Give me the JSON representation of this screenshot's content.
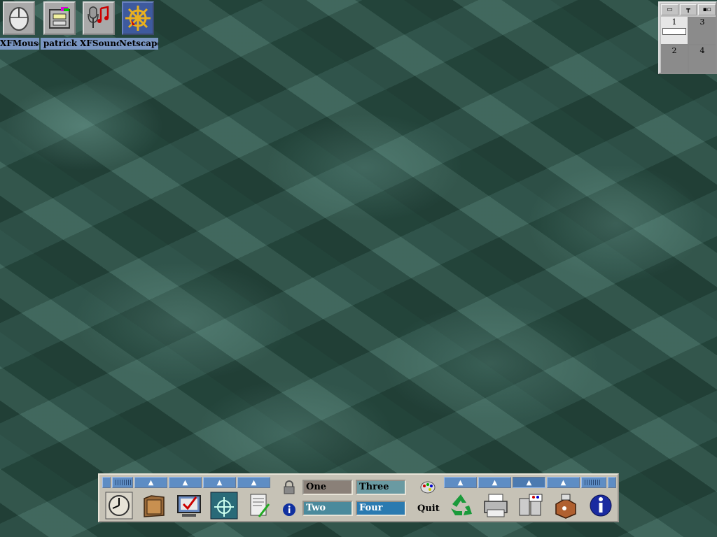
{
  "desktop_icons": [
    {
      "label": "XFMouse",
      "icon": "mouse-icon"
    },
    {
      "label": "patrick",
      "icon": "file-cabinet-icon"
    },
    {
      "label": "XFSound",
      "icon": "microphone-icon"
    },
    {
      "label": "Netscape",
      "icon": "ship-wheel-icon"
    }
  ],
  "pager": {
    "desks": [
      "1",
      "3",
      "2",
      "4"
    ],
    "current_desk": "1"
  },
  "panel": {
    "workspaces": {
      "one": "One",
      "two": "Two",
      "three": "Three",
      "four": "Four"
    },
    "quit_label": "Quit",
    "left_launchers": [
      "clock-icon",
      "folder-icon",
      "checklist-monitor-icon",
      "ship-wheel-icon",
      "text-editor-icon"
    ],
    "right_launchers": [
      "recycle-icon",
      "printer-icon",
      "file-manager-icon",
      "toolbox-icon",
      "info-icon"
    ],
    "colors": {
      "drawer": "#5e8dc4",
      "panel": "#c6c2b6"
    }
  }
}
